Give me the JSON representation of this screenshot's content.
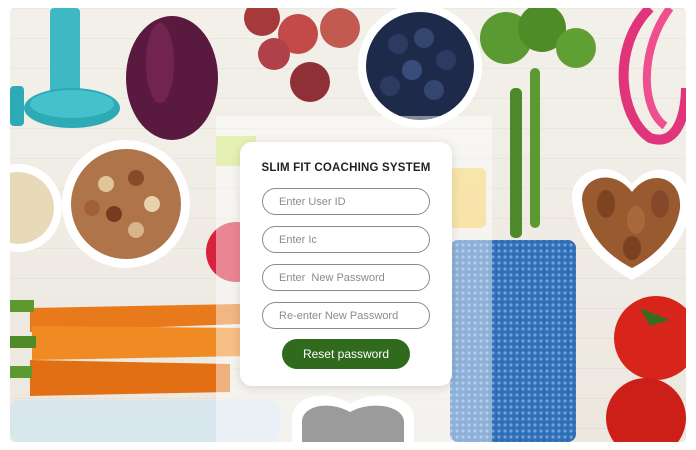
{
  "login_card": {
    "title": "SLIM FIT COACHING SYSTEM",
    "fields": {
      "user_id_placeholder": "Enter User ID",
      "ic_placeholder": "Enter Ic",
      "new_password_placeholder": "Enter  New Password",
      "reenter_password_placeholder": "Re-enter New Password"
    },
    "reset_button_label": "Reset password"
  },
  "colors": {
    "button_green": "#2f6a1d",
    "card_background": "#ffffff"
  }
}
